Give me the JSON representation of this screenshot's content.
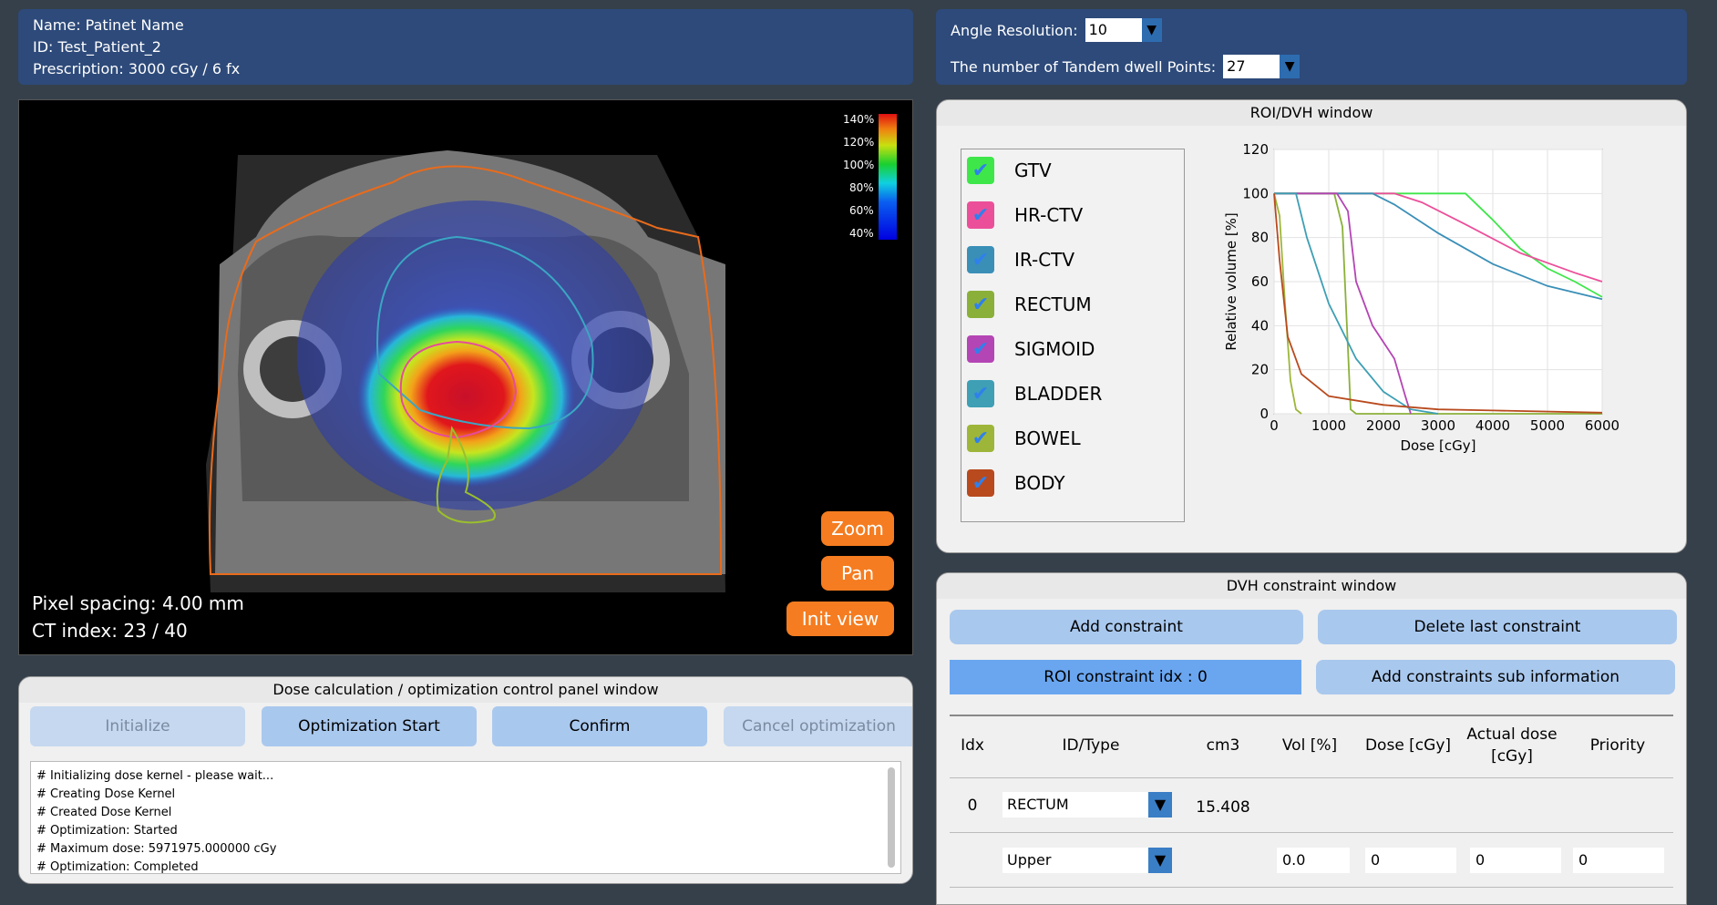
{
  "patient": {
    "name_line": "Name: Patinet Name",
    "id_line": "ID: Test_Patient_2",
    "prescription_line": "Prescription: 3000 cGy / 6 fx"
  },
  "settings": {
    "angle_label": "Angle Resolution:",
    "angle_value": "10",
    "tandem_label": "The number of Tandem dwell Points:",
    "tandem_value": "27"
  },
  "viewer": {
    "pixel_spacing": "Pixel spacing: 4.00 mm",
    "ct_index": "CT index: 23 / 40",
    "zoom_label": "Zoom",
    "pan_label": "Pan",
    "init_label": "Init view",
    "colorbar_labels": [
      "140%",
      "120%",
      "100%",
      "80%",
      "60%",
      "40%"
    ]
  },
  "control_panel": {
    "title": "Dose calculation / optimization control panel window",
    "initialize_label": "Initialize",
    "start_label": "Optimization Start",
    "confirm_label": "Confirm",
    "cancel_label": "Cancel optimization",
    "log_lines": [
      "# Initializing dose kernel - please wait...",
      "# Creating Dose Kernel",
      "# Created Dose Kernel",
      "# Optimization: Started",
      "# Maximum dose: 5971975.000000 cGy",
      "# Optimization: Completed"
    ]
  },
  "roi_window": {
    "title": "ROI/DVH window",
    "rois": [
      {
        "label": "GTV",
        "color": "#3ee64a"
      },
      {
        "label": "HR-CTV",
        "color": "#ec4f9a"
      },
      {
        "label": "IR-CTV",
        "color": "#3a8fb7"
      },
      {
        "label": "RECTUM",
        "color": "#8bb03a"
      },
      {
        "label": "SIGMOID",
        "color": "#b445b4"
      },
      {
        "label": "BLADDER",
        "color": "#3e9fb5"
      },
      {
        "label": "BOWEL",
        "color": "#9db63a"
      },
      {
        "label": "BODY",
        "color": "#b84a1e"
      }
    ]
  },
  "chart_data": {
    "type": "line",
    "xlabel": "Dose [cGy]",
    "ylabel": "Relative volume [%]",
    "xlim": [
      0,
      6000
    ],
    "ylim": [
      0,
      120
    ],
    "x_ticks": [
      "0",
      "1000",
      "2000",
      "3000",
      "4000",
      "5000",
      "6000"
    ],
    "y_ticks": [
      "0",
      "20",
      "40",
      "60",
      "80",
      "100",
      "120"
    ],
    "grid": true,
    "series": [
      {
        "color": "#3ee64a",
        "x": [
          0,
          3500,
          4000,
          4500,
          5000,
          5500,
          6000
        ],
        "y": [
          100,
          100,
          88,
          75,
          66,
          60,
          53
        ]
      },
      {
        "color": "#ec4f9a",
        "x": [
          0,
          2200,
          2700,
          3500,
          4500,
          5500,
          6000
        ],
        "y": [
          100,
          100,
          96,
          86,
          73,
          64,
          60
        ]
      },
      {
        "color": "#3a8fb7",
        "x": [
          0,
          1800,
          2200,
          3000,
          4000,
          5000,
          6000
        ],
        "y": [
          100,
          100,
          95,
          82,
          68,
          58,
          52
        ]
      },
      {
        "color": "#8bb03a",
        "x": [
          0,
          1100,
          1250,
          1350,
          1400,
          1500,
          6000
        ],
        "y": [
          100,
          100,
          85,
          30,
          2,
          0,
          0
        ]
      },
      {
        "color": "#b445b4",
        "x": [
          0,
          1150,
          1350,
          1500,
          1800,
          2200,
          2400,
          2500
        ],
        "y": [
          100,
          100,
          92,
          60,
          40,
          25,
          8,
          0
        ]
      },
      {
        "color": "#3e9fb5",
        "x": [
          0,
          400,
          600,
          1000,
          1500,
          2000,
          2500,
          3000
        ],
        "y": [
          100,
          100,
          80,
          50,
          25,
          10,
          2,
          0
        ]
      },
      {
        "color": "#9db63a",
        "x": [
          0,
          100,
          200,
          300,
          400,
          500
        ],
        "y": [
          100,
          90,
          50,
          15,
          2,
          0
        ]
      },
      {
        "color": "#b84a1e",
        "x": [
          0,
          100,
          250,
          500,
          1000,
          2000,
          3000,
          4000,
          6000
        ],
        "y": [
          100,
          70,
          35,
          18,
          8,
          4,
          2,
          1.5,
          0.5
        ]
      }
    ]
  },
  "dvh_window": {
    "title": "DVH constraint window",
    "add_label": "Add constraint",
    "delete_label": "Delete last constraint",
    "roi_idx_label": "ROI constraint idx : 0",
    "sub_info_label": "Add constraints sub information",
    "headers": [
      "Idx",
      "ID/Type",
      "cm3",
      "Vol [%]",
      "Dose [cGy]",
      "Actual dose [cGy]",
      "Priority"
    ],
    "row1": {
      "idx": "0",
      "roi": "RECTUM",
      "cm3": "15.408"
    },
    "row2": {
      "type": "Upper",
      "vol": "0.0",
      "dose": "0",
      "actual": "0",
      "priority": "0"
    }
  }
}
